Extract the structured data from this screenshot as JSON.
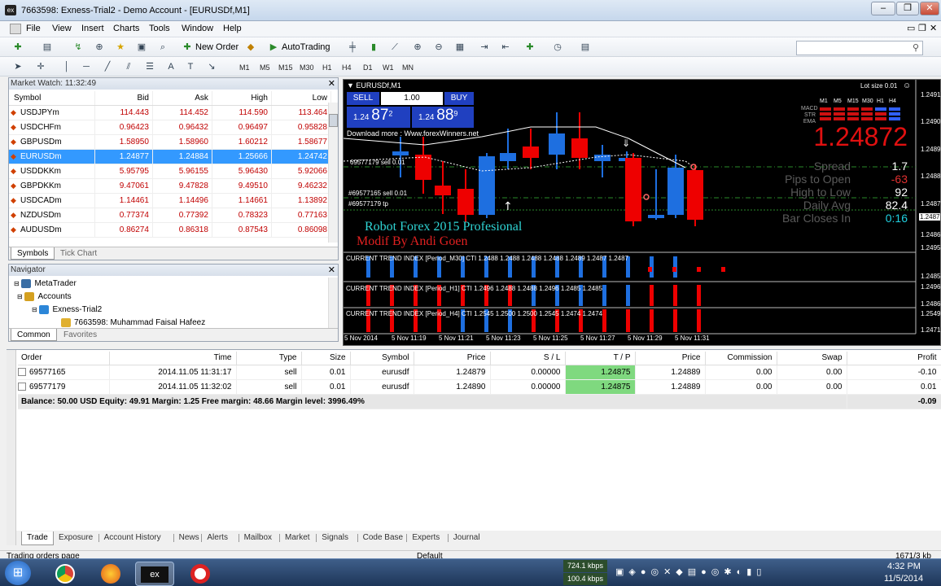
{
  "window": {
    "title": "7663598: Exness-Trial2 - Demo Account - [EURUSDf,M1]"
  },
  "menu": [
    "File",
    "View",
    "Insert",
    "Charts",
    "Tools",
    "Window",
    "Help"
  ],
  "toolbar": {
    "new_order": "New Order",
    "autotrading": "AutoTrading"
  },
  "timeframes": [
    "M1",
    "M5",
    "M15",
    "M30",
    "H1",
    "H4",
    "D1",
    "W1",
    "MN"
  ],
  "market_watch": {
    "title": "Market Watch: 11:32:49",
    "columns": [
      "Symbol",
      "Bid",
      "Ask",
      "High",
      "Low"
    ],
    "rows": [
      {
        "symbol": "USDJPYm",
        "bid": "114.443",
        "ask": "114.452",
        "high": "114.590",
        "low": "113.464"
      },
      {
        "symbol": "USDCHFm",
        "bid": "0.96423",
        "ask": "0.96432",
        "high": "0.96497",
        "low": "0.95828"
      },
      {
        "symbol": "GBPUSDm",
        "bid": "1.58950",
        "ask": "1.58960",
        "high": "1.60212",
        "low": "1.58677"
      },
      {
        "symbol": "EURUSDm",
        "bid": "1.24877",
        "ask": "1.24884",
        "high": "1.25666",
        "low": "1.24742"
      },
      {
        "symbol": "USDDKKm",
        "bid": "5.95795",
        "ask": "5.96155",
        "high": "5.96430",
        "low": "5.92066"
      },
      {
        "symbol": "GBPDKKm",
        "bid": "9.47061",
        "ask": "9.47828",
        "high": "9.49510",
        "low": "9.46232"
      },
      {
        "symbol": "USDCADm",
        "bid": "1.14461",
        "ask": "1.14496",
        "high": "1.14661",
        "low": "1.13892"
      },
      {
        "symbol": "NZDUSDm",
        "bid": "0.77374",
        "ask": "0.77392",
        "high": "0.78323",
        "low": "0.77163"
      },
      {
        "symbol": "AUDUSDm",
        "bid": "0.86274",
        "ask": "0.86318",
        "high": "0.87543",
        "low": "0.86098"
      }
    ],
    "tabs": [
      "Symbols",
      "Tick Chart"
    ]
  },
  "navigator": {
    "title": "Navigator",
    "items": [
      "MetaTrader",
      "Accounts",
      "Exness-Trial2",
      "7663598: Muhammad Faisal Hafeez"
    ],
    "tabs": [
      "Common",
      "Favorites"
    ]
  },
  "chart": {
    "symbol": "EURUSDf,M1",
    "sell": "SELL",
    "buy": "BUY",
    "lot": "1.00",
    "bid_small": "1.24",
    "bid_big": "87",
    "bid_sup": "2",
    "ask_small": "1.24",
    "ask_big": "88",
    "ask_sup": "9",
    "download": "Download more : Www.forexWinners.net",
    "lot_size": "Lot size 0.01",
    "big_price": "1.24872",
    "stats": [
      {
        "label": "Spread",
        "value": "1.7"
      },
      {
        "label": "Pips to Open",
        "value": "-63"
      },
      {
        "label": "High to Low",
        "value": "92"
      },
      {
        "label": "Daily Avg",
        "value": "82.4"
      },
      {
        "label": "Bar Closes In",
        "value": "0:16"
      }
    ],
    "indicator_rows": [
      "MACD",
      "STR",
      "EMA"
    ],
    "indicator_tfs": [
      "M1",
      "M5",
      "M15",
      "M30",
      "H1",
      "H4"
    ],
    "order_labels": [
      "69577179 sell 0.01",
      "#69577165 sell 0.01",
      "#69577179 tp"
    ],
    "robot_title": "Robot Forex 2015 Profesional",
    "modif": "Modif By Andi Goen",
    "cti": [
      "CURRENT TREND INDEX [Period_M30] CTI 1.2488 1.2488 1.2488 1.2488 1.2489 1.2487 1.2487",
      "CURRENT TREND INDEX [Period_H1] CTI 1.2496 1.2488 1.2488 1.2496 1.2485 1.2485",
      "CURRENT TREND INDEX [Period_H4] CTI 1.2545 1.2500 1.2500 1.2545 1.2474 1.2474"
    ],
    "price_axis": [
      "1.2491",
      "1.2490",
      "1.2489",
      "1.2488",
      "1.2487",
      "1.2486"
    ],
    "price_tag": "1.2487",
    "cti_axis": [
      "1.2495",
      "1.2485",
      "1.2496",
      "1.2486",
      "1.2549",
      "1.2471"
    ],
    "time_axis": [
      "5 Nov 2014",
      "5 Nov 11:19",
      "5 Nov 11:21",
      "5 Nov 11:23",
      "5 Nov 11:25",
      "5 Nov 11:27",
      "5 Nov 11:29",
      "5 Nov 11:31"
    ]
  },
  "terminal": {
    "columns": [
      "Order",
      "Time",
      "Type",
      "Size",
      "Symbol",
      "Price",
      "S / L",
      "T / P",
      "Price",
      "Commission",
      "Swap",
      "Profit"
    ],
    "rows": [
      {
        "order": "69577165",
        "time": "2014.11.05 11:31:17",
        "type": "sell",
        "size": "0.01",
        "symbol": "eurusdf",
        "price": "1.24879",
        "sl": "0.00000",
        "tp": "1.24875",
        "cur": "1.24889",
        "commission": "0.00",
        "swap": "0.00",
        "profit": "-0.10"
      },
      {
        "order": "69577179",
        "time": "2014.11.05 11:32:02",
        "type": "sell",
        "size": "0.01",
        "symbol": "eurusdf",
        "price": "1.24890",
        "sl": "0.00000",
        "tp": "1.24875",
        "cur": "1.24889",
        "commission": "0.00",
        "swap": "0.00",
        "profit": "0.01"
      }
    ],
    "balance": "Balance: 50.00 USD  Equity: 49.91  Margin: 1.25  Free margin: 48.66  Margin level: 3996.49%",
    "total": "-0.09",
    "tabs": [
      "Trade",
      "Exposure",
      "Account History",
      "News",
      "Alerts",
      "Mailbox",
      "Market",
      "Signals",
      "Code Base",
      "Experts",
      "Journal"
    ]
  },
  "status": {
    "left": "Trading orders page",
    "mid": "Default",
    "right": "1671/3 kb"
  },
  "taskbar": {
    "net_up": "724.1 kbps",
    "net_down": "100.4 kbps",
    "time": "4:32 PM",
    "date": "11/5/2014"
  }
}
